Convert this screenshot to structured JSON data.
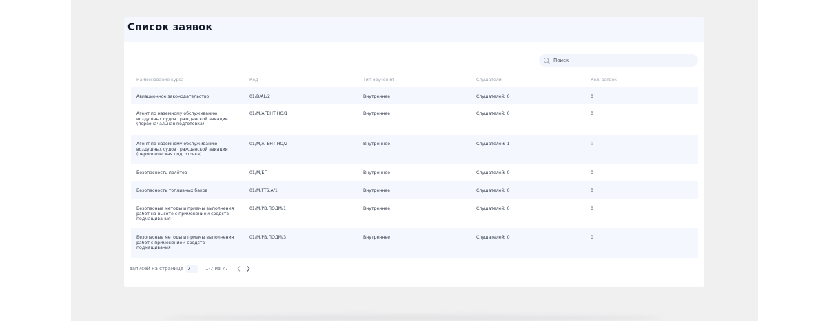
{
  "page": {
    "title": "Список заявок"
  },
  "search": {
    "placeholder": "Поиск",
    "value": ""
  },
  "columns": [
    "Наименование курса",
    "Код",
    "Тип обучения",
    "Слушатели",
    "Кол. заявок"
  ],
  "rows": [
    {
      "name": "Авиационное законодательство",
      "code": "01/В/AL/2",
      "type": "Внутреннее",
      "listeners": "Слушателей: 0",
      "count": "0"
    },
    {
      "name": "Агент по наземному обслуживанию воздушных судов гражданской авиации (первоначальная подготовка)",
      "code": "01/М/АГЕНТ.НО/1",
      "type": "Внутреннее",
      "listeners": "Слушателей: 0",
      "count": "0"
    },
    {
      "name": "Агент по наземному обслуживанию воздушных судов гражданской авиации (периодическая подготовка)",
      "code": "01/М/АГЕНТ.НО/2",
      "type": "Внутреннее",
      "listeners": "Слушателей: 1",
      "count": "1"
    },
    {
      "name": "Безопасность полётов",
      "code": "01/М/БП",
      "type": "Внутреннее",
      "listeners": "Слушателей: 0",
      "count": "0"
    },
    {
      "name": "Безопасность топливных баков",
      "code": "01/М/FTS.А/1",
      "type": "Внутреннее",
      "listeners": "Слушателей: 0",
      "count": "0"
    },
    {
      "name": "Безопасные методы и приемы выполнения работ на высоте с применением средств подмащивания",
      "code": "01/М/РВ.ПОДМ/1",
      "type": "Внутреннее",
      "listeners": "Слушателей: 0",
      "count": "0"
    },
    {
      "name": "Безопасные методы и приемы выполнения работ с применением средств подмащивания",
      "code": "01/М/РВ.ПОДМ/3",
      "type": "Внутреннее",
      "listeners": "Слушателей: 0",
      "count": "0"
    }
  ],
  "pagination": {
    "per_page_label": "записей на странице",
    "per_page_value": "7",
    "range": "1-7 из 77"
  },
  "colors": {
    "accent_count": "#9aa8c7",
    "row_alt": "#f4f7fd"
  }
}
